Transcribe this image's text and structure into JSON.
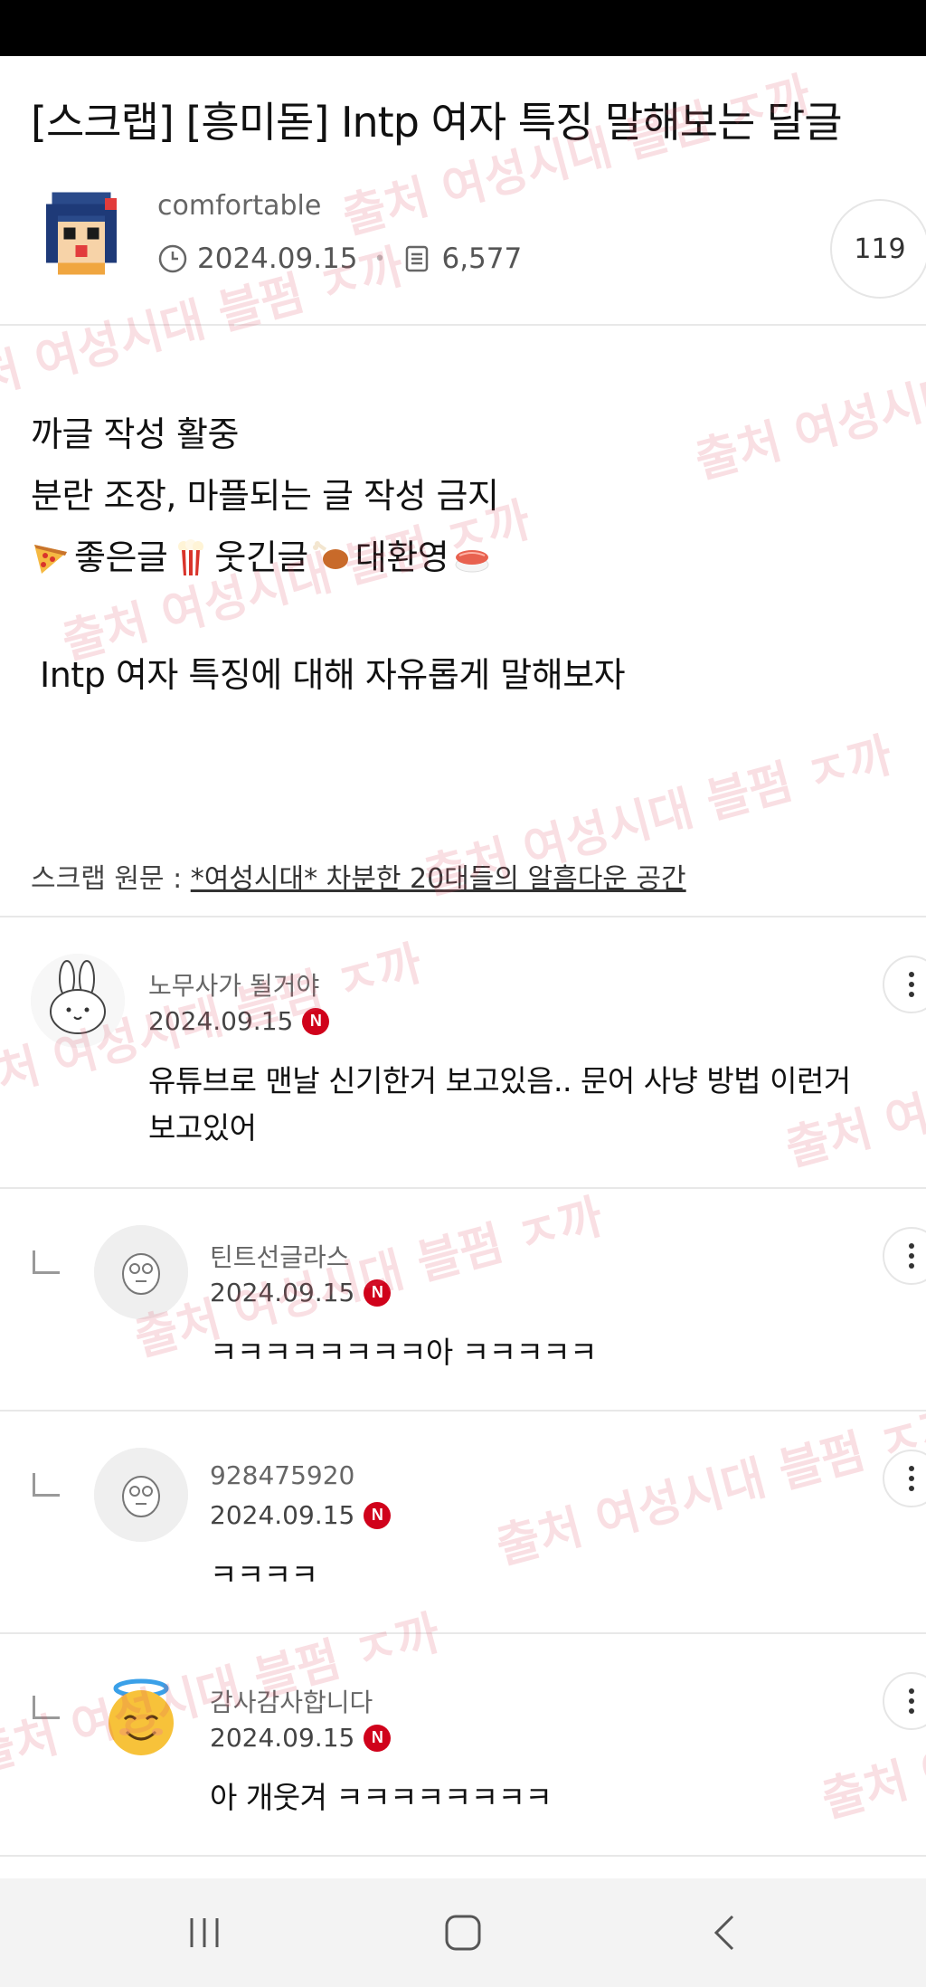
{
  "post": {
    "title": "[스크랩] [흥미돋] Intp 여자 특징 말해보는 달글",
    "author": "comfortable",
    "date": "2024.09.15",
    "views": "6,577",
    "comment_count": "119",
    "body": {
      "line1": "까글 작성 활중",
      "line2": "분란 조장, 마플되는 글 작성 금지",
      "emoji_line": {
        "good": "좋은글",
        "funny": "웃긴글",
        "welcome": "대환영"
      },
      "line4": "Intp 여자 특징에 대해 자유롭게 말해보자"
    },
    "scrap": {
      "label": "스크랩 원문 : ",
      "link": "*여성시대* 차분한 20대들의 알흠다운 공간"
    }
  },
  "comments": [
    {
      "name": "노무사가 될거야",
      "date": "2024.09.15",
      "badge": "N",
      "text_line1": "유튜브로 맨날 신기한거 보고있음.. 문어 사냥 방법 이런거",
      "text_line2": "보고있어",
      "avatar": "bunny-avatar",
      "is_reply": false
    },
    {
      "name": "틴트선글라스",
      "date": "2024.09.15",
      "badge": "N",
      "text_line1": "ㅋㅋㅋㅋㅋㅋㅋㅋ아 ㅋㅋㅋㅋㅋ",
      "avatar": "default-avatar",
      "is_reply": true
    },
    {
      "name": "928475920",
      "date": "2024.09.15",
      "badge": "N",
      "text_line1": "ㅋㅋㅋㅋ",
      "avatar": "default-avatar",
      "is_reply": true
    },
    {
      "name": "감사감사합니다",
      "date": "2024.09.15",
      "badge": "N",
      "text_line1": "아 개웃겨 ㅋㅋㅋㅋㅋㅋㅋㅋ",
      "avatar": "angel-emoji-avatar",
      "is_reply": true
    }
  ],
  "watermark_text": "출처 여성시대 블펌 ㅈ까",
  "colors": {
    "badge": "#d0021b",
    "watermark": "#dc5064"
  },
  "nav": {
    "recent_icon": "recent-apps-icon",
    "home_icon": "home-icon",
    "back_icon": "back-icon"
  }
}
